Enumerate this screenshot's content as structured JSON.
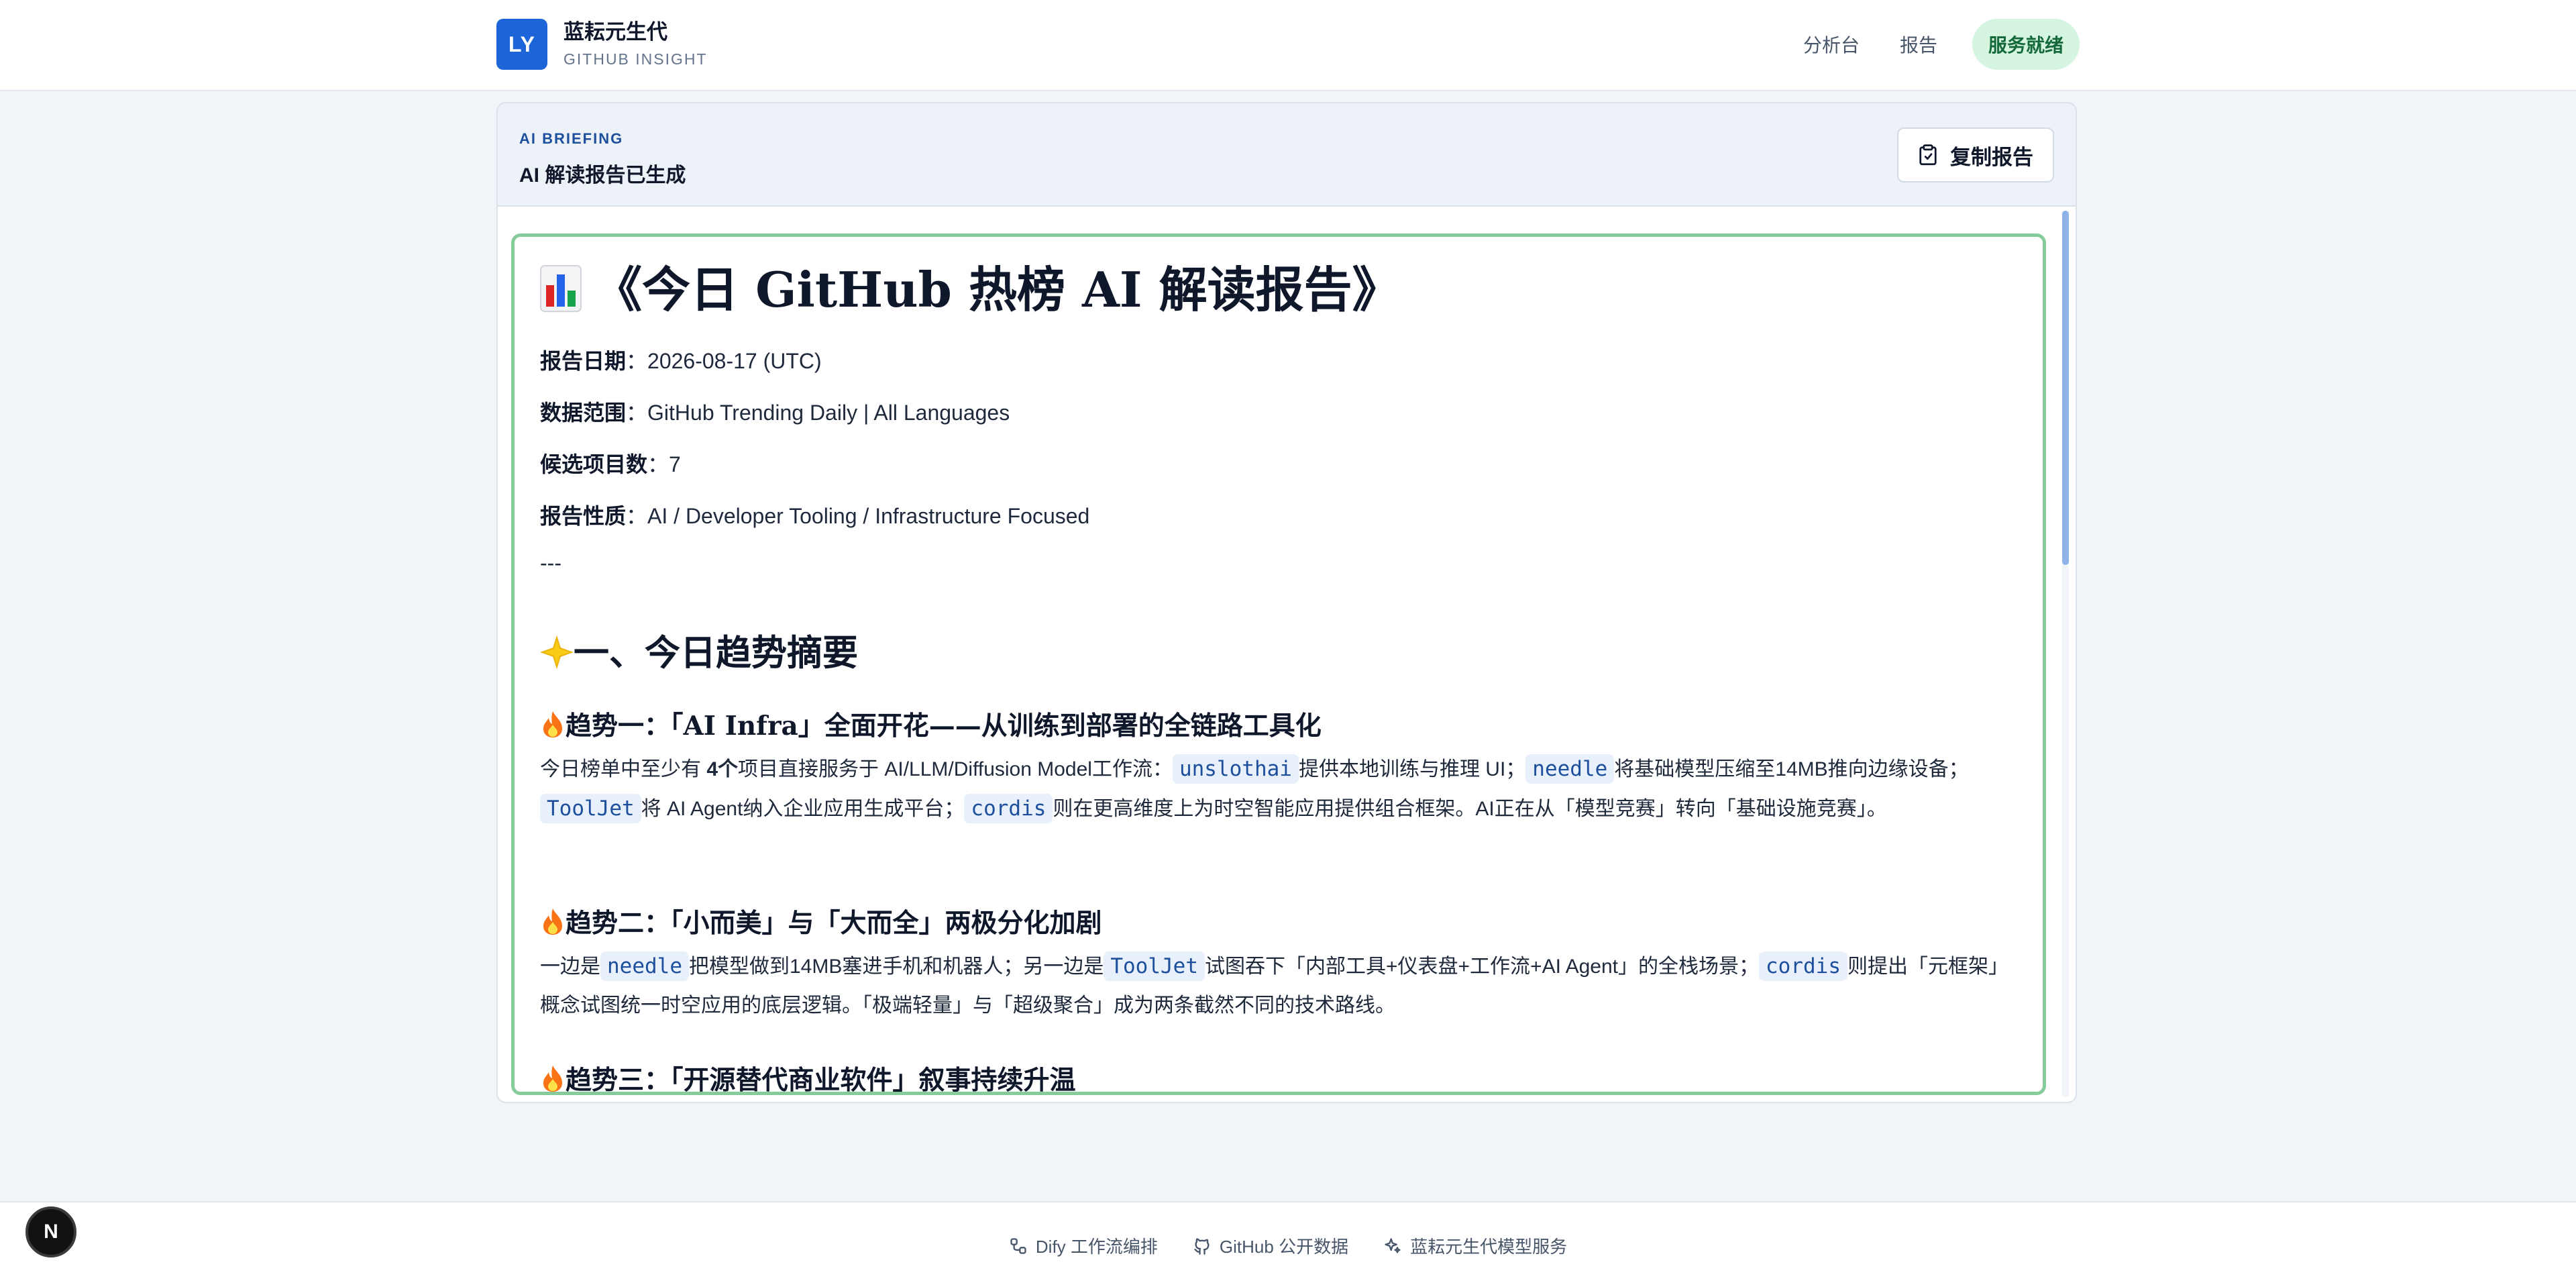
{
  "brand": {
    "logo": "LY",
    "name": "蓝耘元生代",
    "subtitle": "GITHUB INSIGHT"
  },
  "nav": {
    "items": [
      "分析台",
      "报告"
    ],
    "status": "服务就绪"
  },
  "card": {
    "kicker": "AI BRIEFING",
    "title": "AI 解读报告已生成",
    "copy_label": "复制报告"
  },
  "report": {
    "title": "《今日 GitHub 热榜 AI 解读报告》",
    "meta": [
      {
        "label": "报告日期",
        "value": "2026-08-17 (UTC)"
      },
      {
        "label": "数据范围",
        "value": "GitHub Trending Daily | All Languages"
      },
      {
        "label": "候选项目数",
        "value": "7"
      },
      {
        "label": "报告性质",
        "value": "AI / Developer Tooling / Infrastructure Focused"
      }
    ],
    "separator": "---",
    "section1": "一、今日趋势摘要",
    "trend1": {
      "title": "趋势一：「AI Infra」全面开花——从训练到部署的全链路工具化",
      "t1": "今日榜单中至少有 ",
      "bold": "4个",
      "t2": "项目直接服务于 AI/LLM/Diffusion Model工作流：",
      "c1": "unslothai",
      "t3": "提供本地训练与推理 UI；",
      "c2": "needle",
      "t4": "将基础模型压缩至14MB推向边缘设备；",
      "c3": "ToolJet",
      "t5": "将 AI Agent纳入企业应用生成平台；",
      "c4": "cordis",
      "t6": "则在更高维度上为时空智能应用提供组合框架。AI正在从「模型竞赛」转向「基础设施竞赛」。"
    },
    "trend2": {
      "title": "趋势二：「小而美」与「大而全」两极分化加剧",
      "t1": "一边是",
      "c1": "needle",
      "t2": "把模型做到14MB塞进手机和机器人；另一边是",
      "c2": "ToolJet",
      "t3": "试图吞下「内部工具+仪表盘+工作流+AI Agent」的全栈场景；",
      "c3": "cordis",
      "t4": "则提出「元框架」概念试图统一时空应用的底层逻辑。「极端轻量」与「超级聚合」成为两条截然不同的技术路线。"
    },
    "trend3": {
      "title": "趋势三：「开源替代商业软件」叙事持续升温"
    }
  },
  "footer": {
    "items": [
      "Dify 工作流编排",
      "GitHub 公开数据",
      "蓝耘元生代模型服务"
    ]
  },
  "next_badge": "N",
  "colors": {
    "accent": "#1d64d8",
    "status_bg": "#d6f5e1",
    "status_text": "#14693a",
    "report_border": "#86cc9a"
  }
}
